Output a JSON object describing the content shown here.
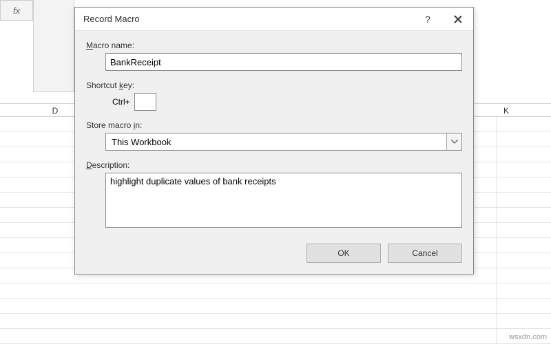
{
  "dialog": {
    "title": "Record Macro",
    "macroNameLabelPrefix": "M",
    "macroNameLabelRest": "acro name:",
    "macroName": "BankReceipt",
    "shortcutLabelPrefix": "Shortcut ",
    "shortcutLabelU": "k",
    "shortcutLabelRest": "ey:",
    "ctrlLabel": "Ctrl+",
    "shortcutKey": "",
    "storeLabelPrefix": "Store macro ",
    "storeLabelU": "i",
    "storeLabelRest": "n:",
    "storeValue": "This Workbook",
    "descLabelU": "D",
    "descLabelRest": "escription:",
    "description": "highlight duplicate values of bank receipts",
    "ok": "OK",
    "cancel": "Cancel",
    "help": "?"
  },
  "background": {
    "fx": "fx",
    "colD": "D",
    "colK": "K"
  },
  "watermark": "wsxdn.com"
}
